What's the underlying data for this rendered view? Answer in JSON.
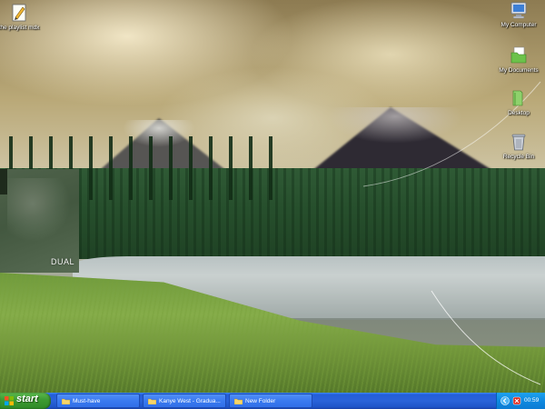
{
  "desktop": {
    "icons": [
      {
        "id": "playlist",
        "label": "the playlist mdx",
        "icon": "pencil-doc-icon"
      },
      {
        "id": "my-computer",
        "label": "My Computer",
        "icon": "monitor-icon"
      },
      {
        "id": "my-documents",
        "label": "My Documents",
        "icon": "documents-folder-icon"
      },
      {
        "id": "desktop",
        "label": "Desktop",
        "icon": "green-folder-icon"
      },
      {
        "id": "recycle-bin",
        "label": "Recycle Bin",
        "icon": "recycle-bin-icon"
      }
    ]
  },
  "widget": {
    "title": "DUAL"
  },
  "taskbar": {
    "start_label": "start",
    "tasks": [
      {
        "label": "Must-have",
        "icon": "folder-icon"
      },
      {
        "label": "Kanye West - Gradua...",
        "icon": "folder-icon"
      },
      {
        "label": "New Folder",
        "icon": "folder-icon"
      }
    ],
    "clock": "00:59"
  },
  "colors": {
    "taskbar_blue": "#245edb",
    "start_green": "#3c9a32",
    "tray_blue": "#0f8ae0"
  }
}
